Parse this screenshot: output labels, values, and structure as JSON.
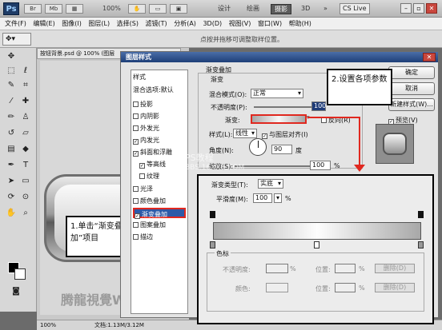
{
  "app": {
    "logo": "Ps",
    "zoom": "100%",
    "workspaces": [
      "设计",
      "绘画",
      "摄影",
      "3D"
    ],
    "active_ws": "摄影",
    "more": "»",
    "cslive": "CS Live"
  },
  "menu": [
    "文件(F)",
    "编辑(E)",
    "图像(I)",
    "图层(L)",
    "选择(S)",
    "滤镜(T)",
    "分析(A)",
    "3D(D)",
    "视图(V)",
    "窗口(W)",
    "帮助(H)"
  ],
  "options_hint": "点按并拖移可调整取样位置。",
  "doc": {
    "tab": "按钮背景.psd @ 100% (图层",
    "zoom": "100%",
    "status": "文档:1.13M/3.12M"
  },
  "watermark": "腾龍視覺WWW",
  "dialog": {
    "title": "图层样式",
    "styles_header": "样式",
    "blend_defaults": "混合选项:默认",
    "styles": [
      {
        "label": "投影",
        "checked": false
      },
      {
        "label": "内阴影",
        "checked": false
      },
      {
        "label": "外发光",
        "checked": false
      },
      {
        "label": "内发光",
        "checked": true
      },
      {
        "label": "斜面和浮雕",
        "checked": true
      },
      {
        "label": "等高线",
        "checked": true
      },
      {
        "label": "纹理",
        "checked": false
      },
      {
        "label": "光泽",
        "checked": false
      },
      {
        "label": "颜色叠加",
        "checked": false
      },
      {
        "label": "渐变叠加",
        "checked": true
      },
      {
        "label": "图案叠加",
        "checked": false
      },
      {
        "label": "描边",
        "checked": false
      }
    ],
    "section": "渐变叠加",
    "subsection": "渐变",
    "blend_mode_label": "混合模式(O):",
    "blend_mode": "正常",
    "opacity_label": "不透明度(P):",
    "opacity": "100",
    "gradient_label": "渐变:",
    "reverse_label": "反向(R)",
    "style_label": "样式(L):",
    "style": "线性",
    "align_label": "与图层对齐(I)",
    "angle_label": "角度(N):",
    "angle": "90",
    "angle_unit": "度",
    "scale_label": "缩放(S):",
    "scale": "100",
    "percent": "%",
    "ok": "确定",
    "cancel": "取消",
    "new_style": "新建样式(W)...",
    "preview": "预览(V)",
    "site_text1": "PS教程",
    "site_text2": "BBS.16XX8.COM"
  },
  "gradient_editor": {
    "type_label": "渐变类型(T):",
    "type": "实底",
    "smooth_label": "平滑度(M):",
    "smooth": "100",
    "percent": "%",
    "stops_title": "色标",
    "opacity_label": "不透明度:",
    "location_label": "位置:",
    "delete_label": "删除(D)",
    "color_label": "颜色:"
  },
  "annotations": {
    "step1": "1.单击“渐变叠加”项目",
    "step2": "2.设置各项参数"
  }
}
